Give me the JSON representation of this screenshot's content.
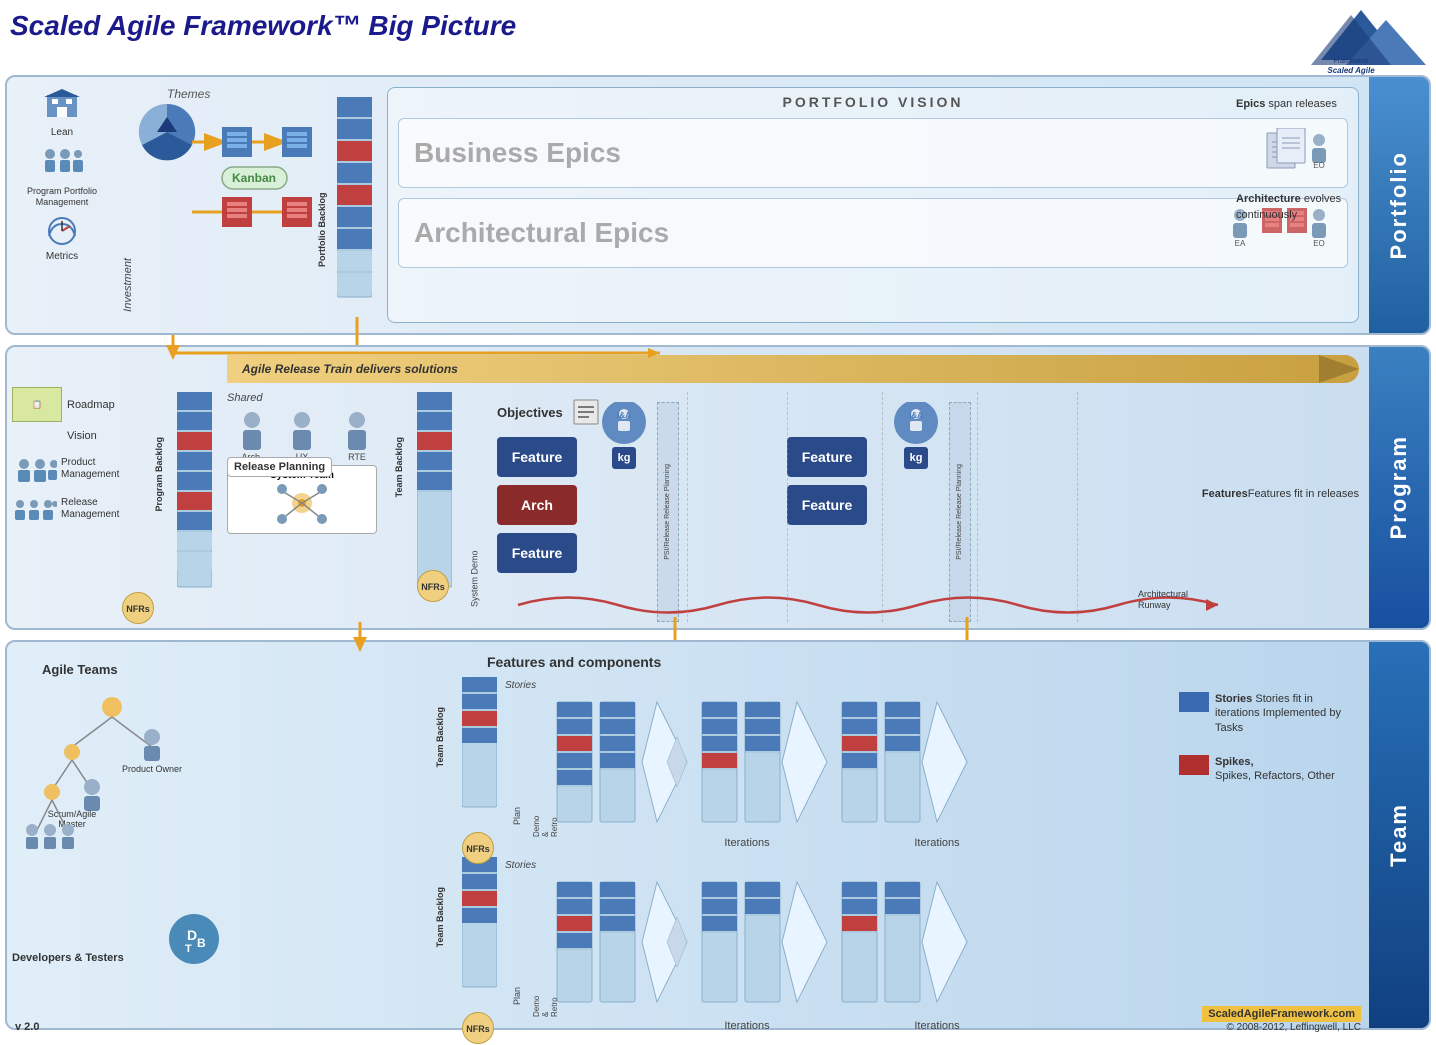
{
  "page": {
    "title": "Scaled Agile Framework™ Big Picture",
    "version": "v 2.0",
    "copyright": "ScaledAgileFramework.com\n© 2008-2012, Leffingwell, LLC"
  },
  "portfolio": {
    "section_label": "Portfolio",
    "vision_title": "PORTFOLIO VISION",
    "business_epics": "Business Epics",
    "arch_epics": "Architectural Epics",
    "backlog_label": "Portfolio Backlog",
    "kanban_label": "Kanban",
    "themes_label": "Themes",
    "investment_label": "Investment",
    "annotation1_bold": "Epics",
    "annotation1_rest": " span releases",
    "annotation2_bold": "Architecture",
    "annotation2_rest": " evolves continuously",
    "eo_label": "EO",
    "ea_label": "EA",
    "lean_label": "Lean",
    "ppm_label": "Program Portfolio Management",
    "metrics_label": "Metrics"
  },
  "program": {
    "section_label": "Program",
    "art_banner": "Agile Release Train delivers solutions",
    "roadmap_label": "Roadmap",
    "vision_label": "Vision",
    "prod_mgmt_label": "Product Management",
    "rel_mgmt_label": "Release Management",
    "shared_label": "Shared",
    "arch_label": "Arch.",
    "ux_label": "UX",
    "rte_label": "RTE",
    "release_planning_label": "Release Planning",
    "system_team_label": "System Team",
    "program_backlog_label": "Program Backlog",
    "team_backlog_label": "Team Backlog",
    "nfrs_label": "NFRs",
    "objectives_label": "Objectives",
    "system_demo_label": "System Demo",
    "ia_label": "I&A",
    "kg_label": "kg",
    "feature_label": "Feature",
    "arch_box_label": "Arch",
    "psi_release_label": "PSI/Release\nRelease Planning",
    "features_fit_label": "Features fit in releases",
    "arch_runway_label": "Architectural Runway"
  },
  "team": {
    "section_label": "Team",
    "features_components_label": "Features and components",
    "agile_teams_label": "Agile Teams",
    "product_owner_label": "Product Owner",
    "scrum_master_label": "Scrum/Agile Master",
    "dev_testers_label": "Developers & Testers",
    "team_backlog_label": "Team Backlog",
    "stories_label": "Stories",
    "plan_label": "Plan",
    "demo_retro_label": "Demo & Retro",
    "iterations_label": "Iterations",
    "nfrs_label": "NFRs",
    "dbt_label": "DBT"
  },
  "legend": {
    "stories_label": "Stories fit in iterations Implemented by Tasks",
    "spikes_label": "Spikes, Refactors, Other",
    "stories_color": "#3a6ab0",
    "spikes_color": "#b03030"
  },
  "colors": {
    "portfolio_bg": "#dce8f4",
    "program_bg": "#ccdff0",
    "team_bg": "#b8d4ec",
    "section_label_portfolio": "#4a90d0",
    "section_label_program": "#3a80c0",
    "section_label_team": "#2870b8",
    "feature_blue": "#2a4a8a",
    "feature_red": "#8a2a2a",
    "orange_flow": "#e8a020",
    "kanban_green": "#448844"
  }
}
